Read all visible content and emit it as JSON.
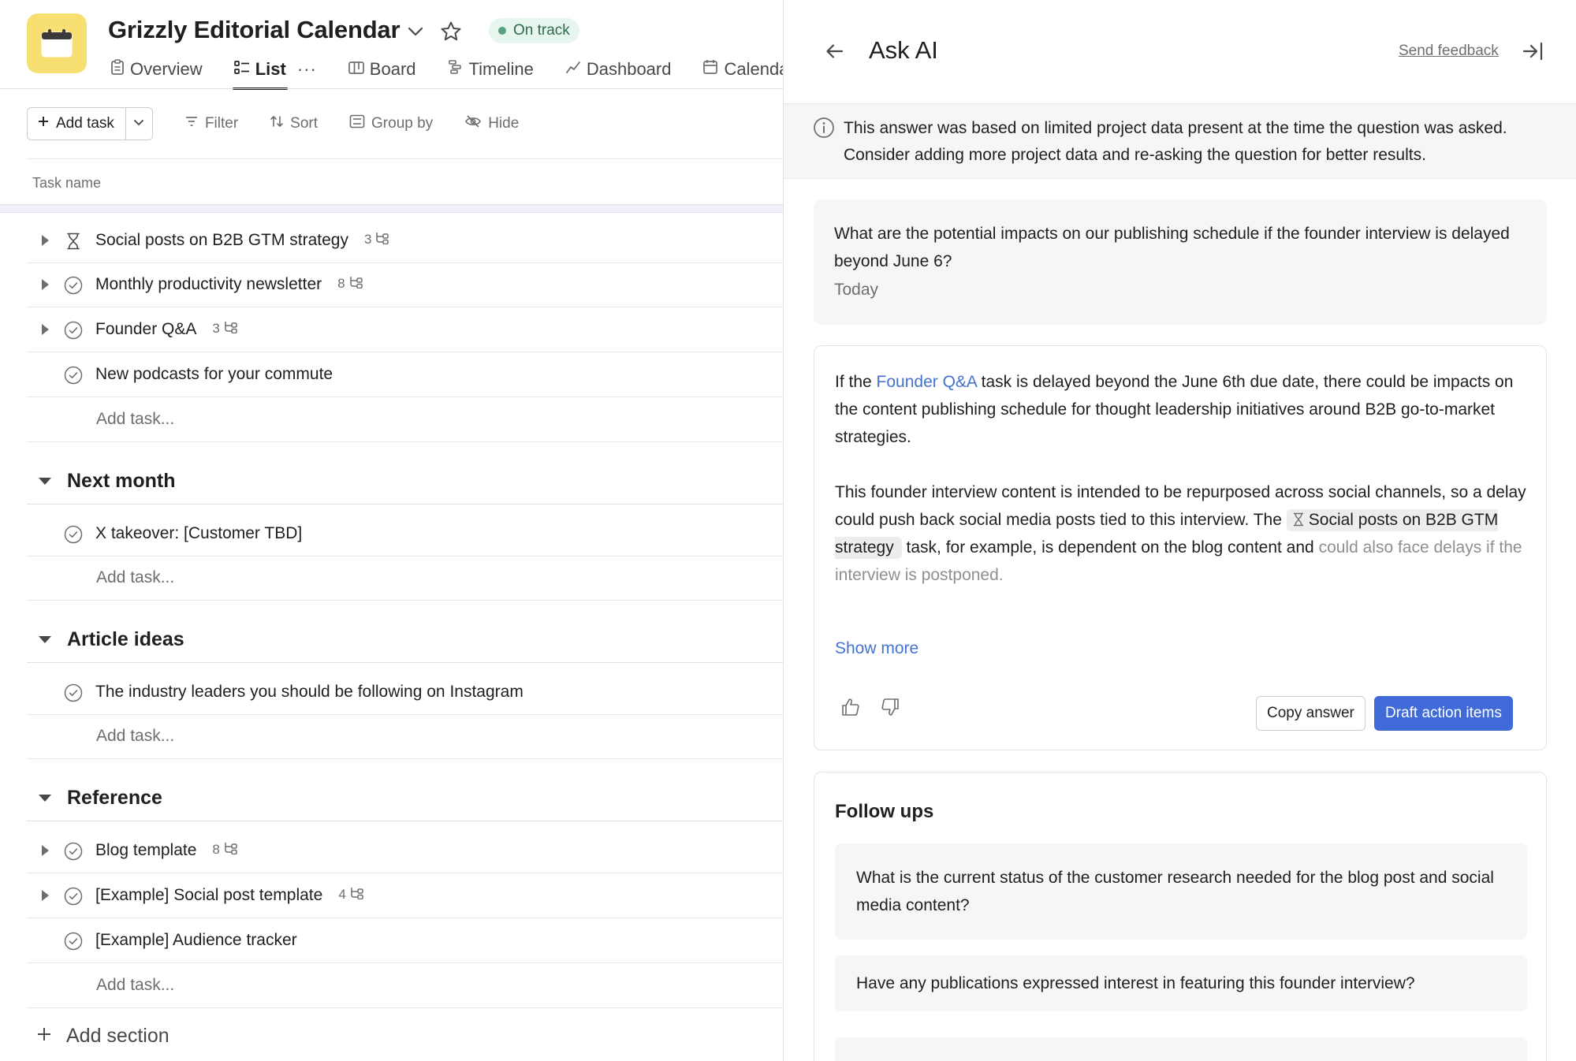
{
  "project": {
    "title": "Grizzly Editorial Calendar",
    "status": "On track",
    "colors": {
      "icon_bg": "#f8df72",
      "status_bg": "#e6f5ee",
      "status_dot": "#58a182"
    }
  },
  "tabs": [
    {
      "label": "Overview",
      "icon": "clipboard-icon",
      "active": false
    },
    {
      "label": "List",
      "icon": "list-icon",
      "active": true
    },
    {
      "label": "Board",
      "icon": "board-icon",
      "active": false
    },
    {
      "label": "Timeline",
      "icon": "timeline-icon",
      "active": false
    },
    {
      "label": "Dashboard",
      "icon": "chart-icon",
      "active": false
    },
    {
      "label": "Calenda",
      "icon": "calendar-icon",
      "active": false
    }
  ],
  "toolbar": {
    "add_task": "Add task",
    "filter": "Filter",
    "sort": "Sort",
    "group_by": "Group by",
    "hide": "Hide"
  },
  "list": {
    "column_header": "Task name",
    "add_task_placeholder": "Add task...",
    "add_section": "Add section",
    "top_tasks": [
      {
        "name": "Social posts on B2B GTM strategy",
        "status": "hourglass",
        "subtasks": "3"
      },
      {
        "name": "Monthly productivity newsletter",
        "status": "check",
        "subtasks": "8"
      },
      {
        "name": "Founder Q&A",
        "status": "check",
        "subtasks": "3"
      },
      {
        "name": "New podcasts for your commute",
        "status": "check",
        "subtasks": ""
      }
    ],
    "sections": [
      {
        "name": "Next month",
        "tasks": [
          {
            "name": "X takeover: [Customer TBD]",
            "subtasks": ""
          }
        ]
      },
      {
        "name": "Article ideas",
        "tasks": [
          {
            "name": "The industry leaders you should be following on Instagram",
            "subtasks": ""
          }
        ]
      },
      {
        "name": "Reference",
        "tasks": [
          {
            "name": "Blog template",
            "subtasks": "8"
          },
          {
            "name": "[Example] Social post template",
            "subtasks": "4"
          },
          {
            "name": "[Example] Audience tracker",
            "subtasks": ""
          }
        ]
      }
    ]
  },
  "panel": {
    "title": "Ask AI",
    "send_feedback": "Send feedback",
    "info": "This answer was based on limited project data present at the time the question was asked. Consider adding more project data and re-asking the question for better results.",
    "question": "What are the potential impacts on our publishing schedule if the founder interview is delayed beyond June 6?",
    "question_date": "Today",
    "answer": {
      "p1_before": "If the ",
      "p1_link": "Founder Q&A",
      "p1_after": " task is delayed beyond the June 6th due date, there could be impacts on the content publishing schedule for thought leadership initiatives around B2B go-to-market strategies.",
      "p2_before": "This founder interview content is intended to be repurposed across social channels, so a delay could push back social media posts tied to this interview. The ",
      "p2_chip": "Social posts on B2B GTM strategy",
      "p2_after": " task, for example, is dependent on the blog content and",
      "p2_faded": "could also face delays if the interview is postponed."
    },
    "show_more": "Show more",
    "copy_answer": "Copy answer",
    "draft_action_items": "Draft action items",
    "followups_title": "Follow ups",
    "followups": [
      "What is the current status of the customer research needed for the blog post and social media content?",
      "Have any publications expressed interest in featuring this founder interview?"
    ],
    "colors": {
      "accent": "#3f6ad8",
      "link": "#4573d2"
    }
  }
}
